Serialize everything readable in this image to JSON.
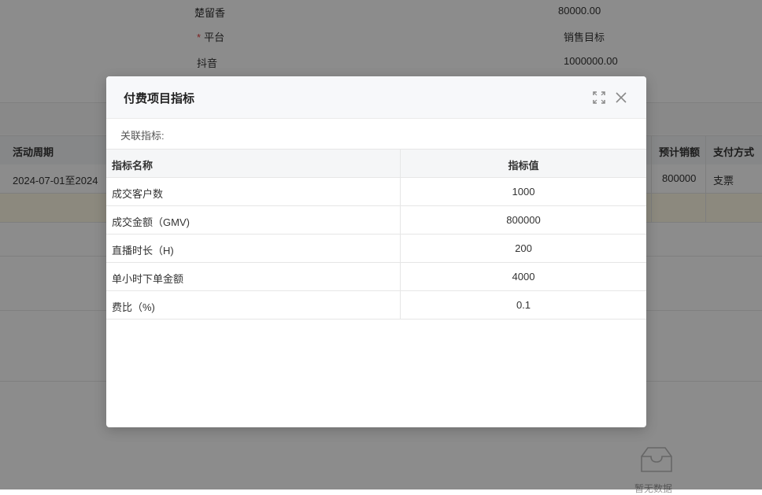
{
  "background": {
    "form_fields": [
      {
        "label": "楚留香",
        "value": "80000.00",
        "required": false
      },
      {
        "label": "平台",
        "value": "销售目标",
        "required": true
      },
      {
        "label": "抖音",
        "value": "1000000.00",
        "required": false
      }
    ],
    "table": {
      "columns": {
        "period": "活动周期",
        "expected_sales": "预计销额",
        "payment": "支付方式"
      },
      "row": {
        "period": "2024-07-01至2024",
        "expected_sales": "800000",
        "payment": "支票"
      }
    },
    "empty_text": "暂无数据"
  },
  "modal": {
    "title": "付费项目指标",
    "fullscreen_icon": "fullscreen-icon",
    "close_icon": "close-icon",
    "related_label": "关联指标:",
    "table": {
      "headers": {
        "name": "指标名称",
        "value": "指标值"
      },
      "rows": [
        {
          "name": "成交客户数",
          "value": "1000"
        },
        {
          "name": "成交金额（GMV)",
          "value": "800000"
        },
        {
          "name": "直播时长（H)",
          "value": "200"
        },
        {
          "name": "单小时下单金额",
          "value": "4000"
        },
        {
          "name": "费比（%)",
          "value": "0.1"
        }
      ]
    }
  }
}
